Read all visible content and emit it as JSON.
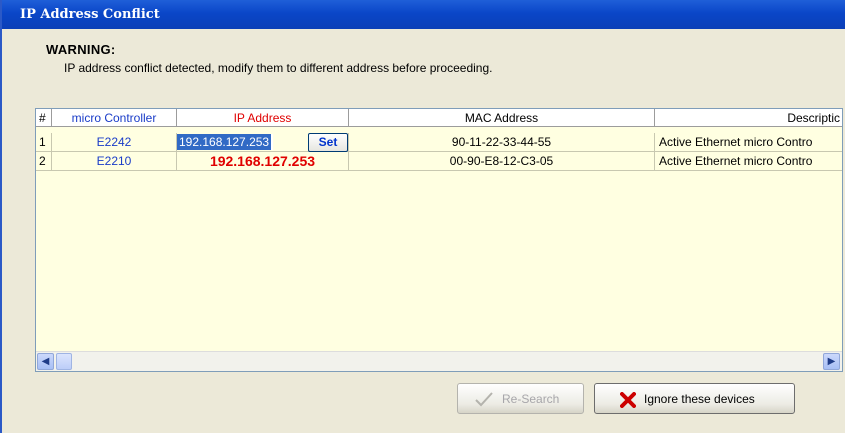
{
  "window": {
    "title": "IP Address Conflict"
  },
  "warning": {
    "heading": "WARNING:",
    "message": "IP address conflict detected, modify them to different address before proceeding."
  },
  "table": {
    "columns": [
      "#",
      "micro Controller",
      "IP Address",
      "MAC Address",
      "Descriptic"
    ],
    "rows": [
      {
        "num": "1",
        "controller": "E2242",
        "ip": "192.168.127.253",
        "mac": "90-11-22-33-44-55",
        "desc": "Active Ethernet micro Contro",
        "editing": true
      },
      {
        "num": "2",
        "controller": "E2210",
        "ip": "192.168.127.253",
        "mac": "00-90-E8-12-C3-05",
        "desc": "Active Ethernet micro Contro",
        "editing": false
      }
    ],
    "set_label": "Set"
  },
  "buttons": {
    "research_label": "Re-Search",
    "ignore_label": "Ignore these devices"
  },
  "colors": {
    "title_bar": "#0a46c8",
    "grid_background": "#ffffe1",
    "controller_text": "#1a3cc8",
    "conflict_ip": "#e00000",
    "ip_header": "#e00000",
    "controller_header": "#1a3cc8"
  }
}
